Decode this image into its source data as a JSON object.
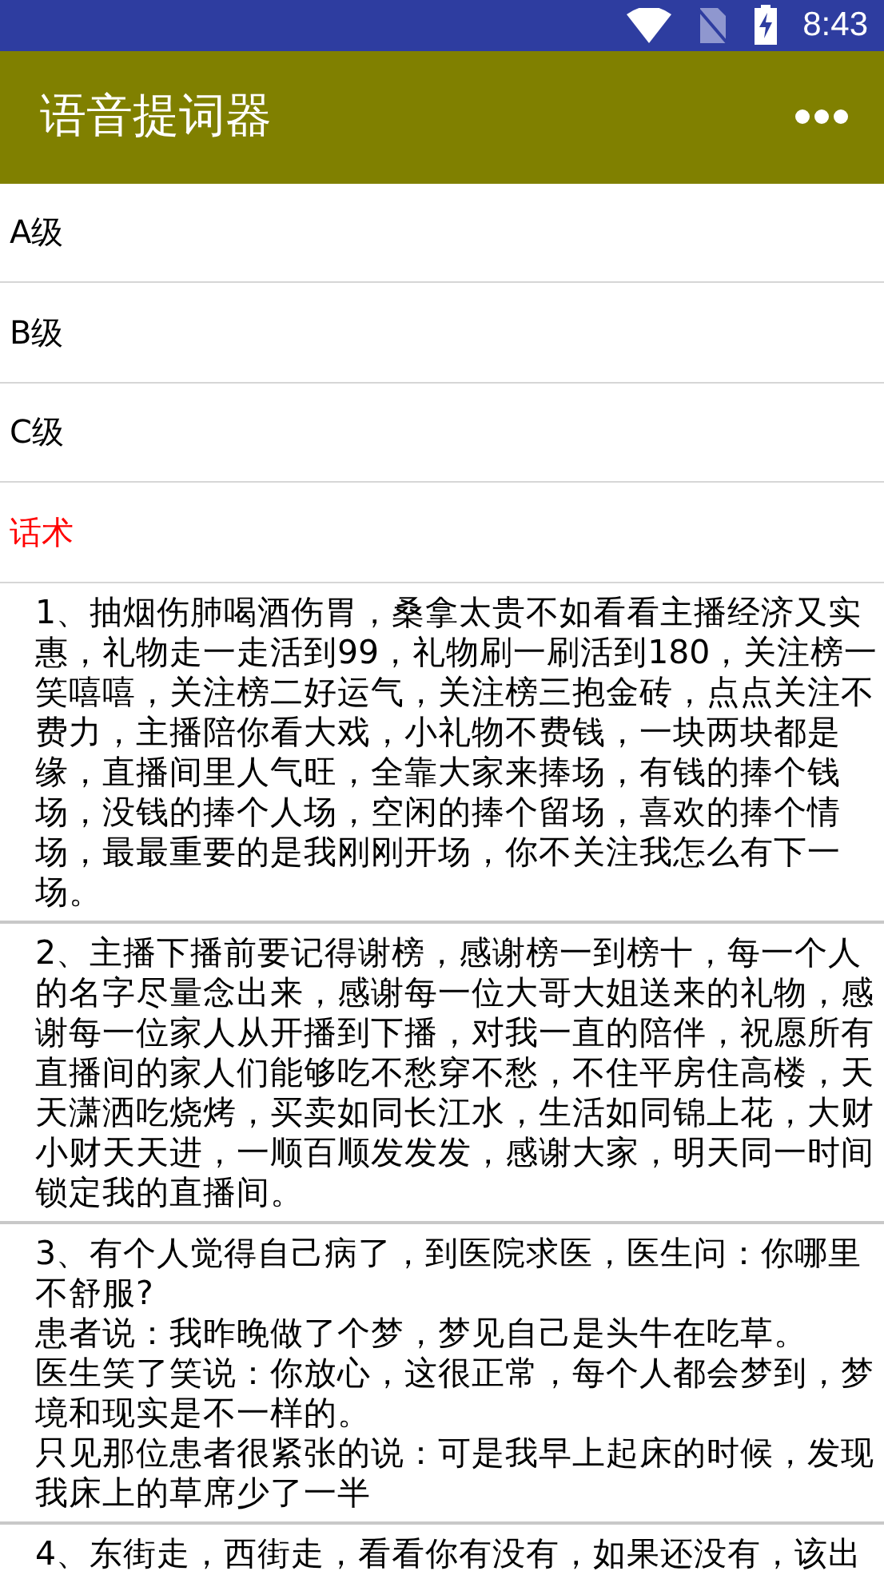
{
  "status_bar": {
    "time": "8:43"
  },
  "app_bar": {
    "title": "语音提词器"
  },
  "categories": [
    {
      "label": "A级",
      "selected": false
    },
    {
      "label": "B级",
      "selected": false
    },
    {
      "label": "C级",
      "selected": false
    },
    {
      "label": "话术",
      "selected": true
    }
  ],
  "scripts": [
    {
      "text": "1、抽烟伤肺喝酒伤胃，桑拿太贵不如看看主播经济又实惠，礼物走一走活到99，礼物刷一刷活到180，关注榜一笑嘻嘻，关注榜二好运气，关注榜三抱金砖，点点关注不费力，主播陪你看大戏，小礼物不费钱，一块两块都是缘，直播间里人气旺，全靠大家来捧场，有钱的捧个钱场，没钱的捧个人场，空闲的捧个留场，喜欢的捧个情场，最最重要的是我刚刚开场，你不关注我怎么有下一场。"
    },
    {
      "text": "2、主播下播前要记得谢榜，感谢榜一到榜十，每一个人的名字尽量念出来，感谢每一位大哥大姐送来的礼物，感谢每一位家人从开播到下播，对我一直的陪伴，祝愿所有直播间的家人们能够吃不愁穿不愁，不住平房住高楼，天天潇洒吃烧烤，买卖如同长江水，生活如同锦上花，大财小财天天进，一顺百顺发发发，感谢大家，明天同一时间锁定我的直播间。"
    },
    {
      "text": "3、有个人觉得自己病了，到医院求医，医生问：你哪里不舒服?",
      "more_lines": [
        "患者说：我昨晚做了个梦，梦见自己是头牛在吃草。",
        "医生笑了笑说：你放心，这很正常，每个人都会梦到，梦境和现实是不一样的。",
        "只见那位患者很紧张的说：可是我早上起床的时候，发现我床上的草席少了一半"
      ]
    },
    {
      "text": "4、东街走，西街走，看看你有没有，如果还没有，该出"
    }
  ]
}
